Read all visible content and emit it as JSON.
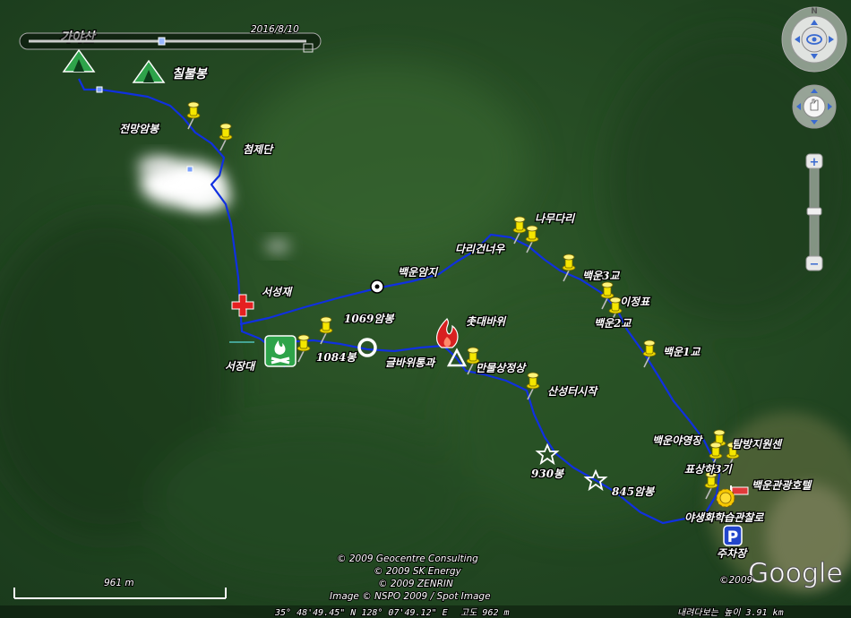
{
  "timeline": {
    "date": "2016/8/10"
  },
  "places": {
    "gayasan": "가야산",
    "chilbulbong": "칠불봉",
    "jeonmangambong": "전망암봉",
    "cheomjedan": "첨제단",
    "seoseongjae": "서성재",
    "seojangdae": "서장대",
    "baekunamji": "백운암지",
    "bong1069": "1069암봉",
    "bong1084": "1084봉",
    "chotdaebawi": "촛대바위",
    "geulbawi": "글바위통과",
    "manmulsang": "만물상정상",
    "dari": "다리건너우",
    "namudari": "나무다리",
    "baekun3": "백운3교",
    "ijeongpyo": "이정표",
    "baekun2": "백운2교",
    "baekun1": "백운1교",
    "sanseong": "산성터시작",
    "bong930": "930봉",
    "bong845": "845암봉",
    "yayeongjang": "백운야영장",
    "tambang": "탐방지원센",
    "pyosang": "표상하3기",
    "baekungwang": "백운관광호텔",
    "yasaeng": "야생화학습관찰로",
    "juchajang": "주차장"
  },
  "credits": {
    "line1": "© 2009 Geocentre Consulting",
    "line2": "© 2009 SK Energy",
    "line3": "© 2009 ZENRIN",
    "line4": "Image © NSPO 2009 / Spot Image"
  },
  "scale": {
    "label": "961 m"
  },
  "status": {
    "coords": "35° 48'49.45\" N  128° 07'49.12\" E",
    "elevation": "고도  962 m",
    "eye_alt": "내려다보는 높이   3.91 km"
  },
  "logo": {
    "text": "Google",
    "year": "©2009"
  },
  "icons": {
    "tent": "tent-icon",
    "pushpin": "pushpin-icon",
    "first-aid": "first-aid-icon",
    "campfire": "campfire-icon",
    "circle": "circle-icon",
    "triangle": "triangle-icon",
    "star": "star-icon",
    "fire": "fire-icon",
    "sun": "sun-icon",
    "parking": "parking-icon",
    "flag": "flag-icon",
    "compass": "compass-icon",
    "pan": "pan-icon",
    "zoom-in": "zoom-in-icon",
    "zoom-out": "zoom-out-icon"
  },
  "colors": {
    "track": "#1030e0",
    "pin": "#f0e000",
    "tent": "#3fb34f",
    "first_aid": "#e52020"
  }
}
